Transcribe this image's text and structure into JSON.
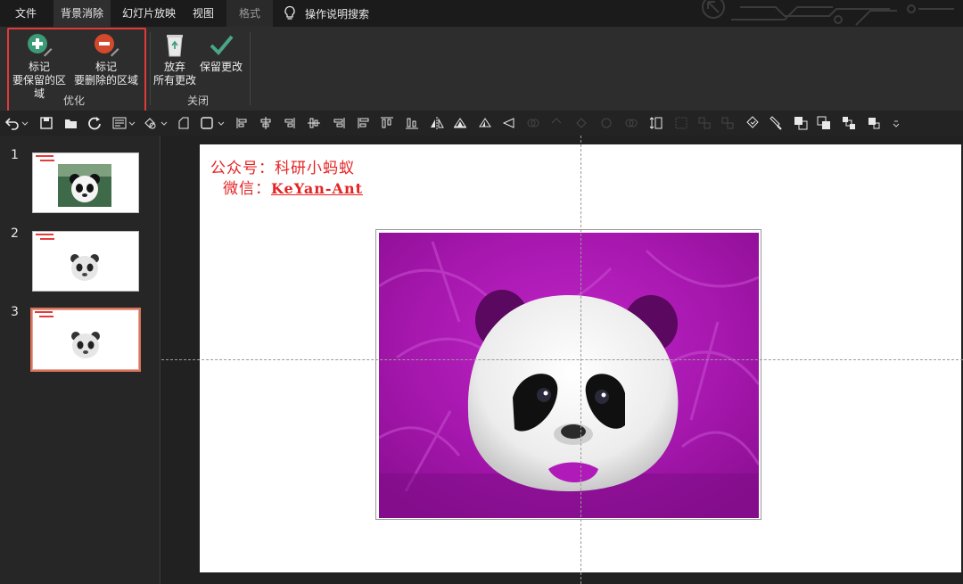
{
  "menu": {
    "file": "文件",
    "background_removal": "背景消除",
    "slideshow": "幻灯片放映",
    "view": "视图",
    "format": "格式",
    "tell_me": "操作说明搜索"
  },
  "ribbon": {
    "mark_keep_line1": "标记",
    "mark_keep_line2": "要保留的区域",
    "mark_remove_line1": "标记",
    "mark_remove_line2": "要删除的区域",
    "group_refine": "优化",
    "discard_line1": "放弃",
    "discard_line2": "所有更改",
    "keep_changes": "保留更改",
    "group_close": "关闭"
  },
  "slides": [
    {
      "number": "1"
    },
    {
      "number": "2"
    },
    {
      "number": "3"
    }
  ],
  "slide": {
    "watermark_line1": "公众号：科研小蚂蚁",
    "watermark_line2_prefix": "微信：",
    "watermark_line2_id": "KeYan-Ant"
  },
  "colors": {
    "accent_red": "#e52222",
    "selection_border": "#d9735c",
    "removal_magenta": "#b01ab8",
    "ribbon_bg": "#2d2d2d"
  }
}
